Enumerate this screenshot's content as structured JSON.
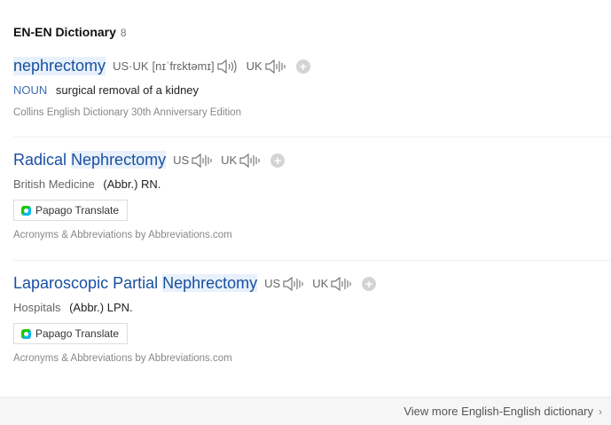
{
  "header": {
    "title": "EN-EN Dictionary",
    "count": "8"
  },
  "entries": [
    {
      "word": "nephrectomy",
      "pron_label": "US·UK",
      "ipa": "[nɪˈfrɛktəmɪ]",
      "uk_label": "UK",
      "pos": "NOUN",
      "definition": "surgical removal of a kidney",
      "source": "Collins English Dictionary 30th Anniversary Edition"
    },
    {
      "word_plain": "Radical ",
      "word_hl": "Nephrectomy",
      "us_label": "US",
      "uk_label": "UK",
      "category": "British Medicine",
      "definition": "(Abbr.) RN.",
      "translate_label": "Papago Translate",
      "source": "Acronyms & Abbreviations by Abbreviations.com"
    },
    {
      "word_plain": "Laparoscopic Partial ",
      "word_hl": "Nephrectomy",
      "us_label": "US",
      "uk_label": "UK",
      "category": "Hospitals",
      "definition": "(Abbr.) LPN.",
      "translate_label": "Papago Translate",
      "source": "Acronyms & Abbreviations by Abbreviations.com"
    }
  ],
  "footer": {
    "more_label": "View more English-English dictionary"
  },
  "icons": {
    "speaker": "speaker-icon",
    "add": "plus-icon",
    "chevron": "chevron-right-icon",
    "papago": "papago-icon"
  },
  "colors": {
    "word": "#1a4fa0",
    "highlight": "#e8f1fb",
    "pos": "#3d6fb0"
  }
}
